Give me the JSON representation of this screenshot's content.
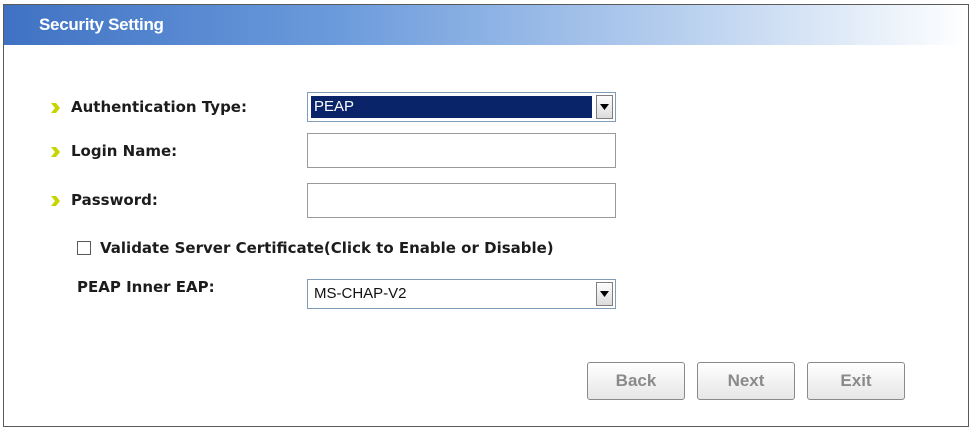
{
  "dialog": {
    "title": "Security Setting"
  },
  "form": {
    "auth_type": {
      "label": "Authentication Type:",
      "selected": "PEAP"
    },
    "login_name": {
      "label": "Login Name:",
      "value": ""
    },
    "password": {
      "label": "Password:",
      "value": ""
    },
    "validate_cert": {
      "label": "Validate Server Certificate(Click to Enable or Disable)",
      "checked": false
    },
    "peap_inner_eap": {
      "label": "PEAP Inner EAP:",
      "selected": "MS-CHAP-V2"
    }
  },
  "buttons": {
    "back": "Back",
    "next": "Next",
    "exit": "Exit"
  },
  "colors": {
    "title_bar": "#3f72c3",
    "arrow_icon": "#c8d400",
    "selection_highlight": "#0a246a"
  }
}
